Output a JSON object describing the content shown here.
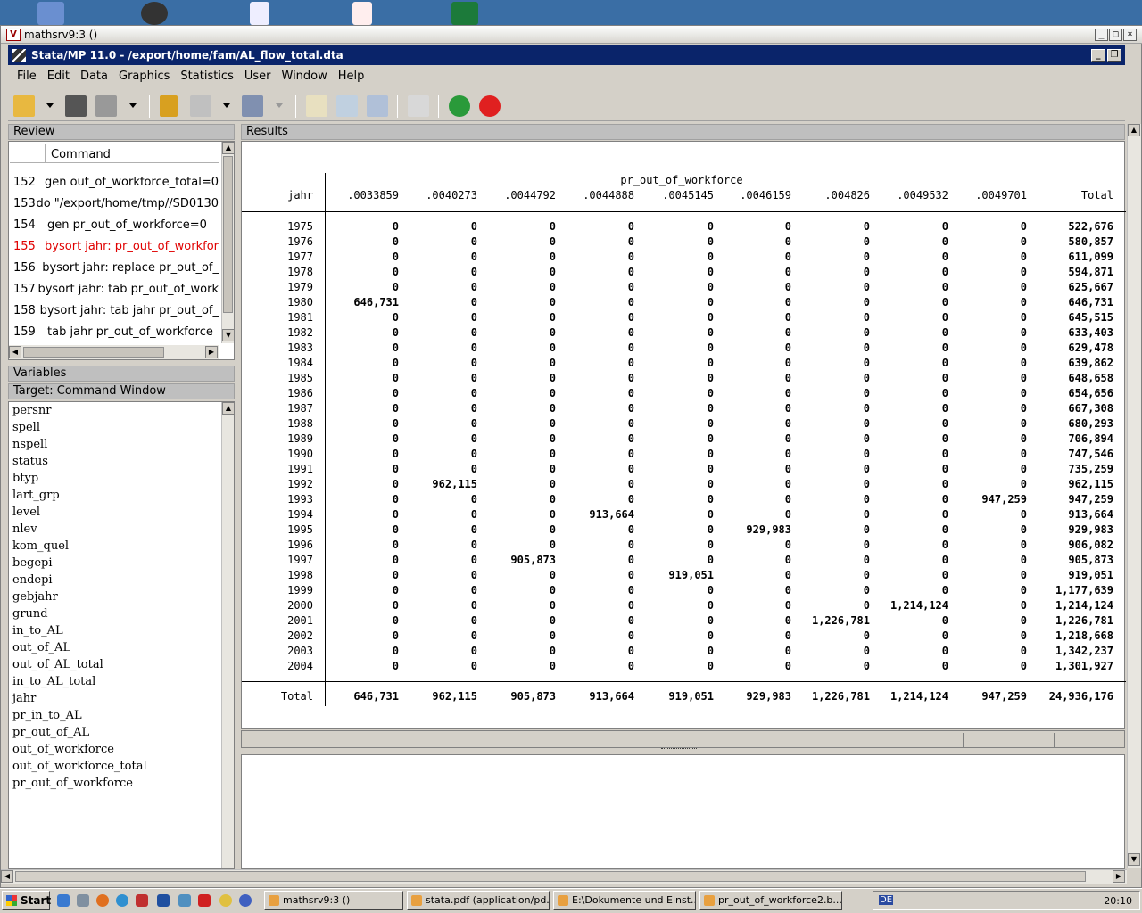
{
  "window": {
    "vnc_title": "mathsrv9:3 ()",
    "stata_title": "Stata/MP 11.0 - /export/home/fam/AL_flow_total.dta"
  },
  "menu": [
    "File",
    "Edit",
    "Data",
    "Graphics",
    "Statistics",
    "User",
    "Window",
    "Help"
  ],
  "review": {
    "header": "Review",
    "column": "Command",
    "rows": [
      {
        "n": "152",
        "cmd": "gen out_of_workforce_total=0"
      },
      {
        "n": "153",
        "cmd": "do \"/export/home/tmp//SD0130"
      },
      {
        "n": "154",
        "cmd": "gen pr_out_of_workforce=0"
      },
      {
        "n": "155",
        "cmd": "bysort jahr: pr_out_of_workfor"
      },
      {
        "n": "156",
        "cmd": "bysort jahr: replace pr_out_of_"
      },
      {
        "n": "157",
        "cmd": "bysort jahr: tab pr_out_of_work"
      },
      {
        "n": "158",
        "cmd": "bysort jahr: tab jahr pr_out_of_"
      },
      {
        "n": "159",
        "cmd": "tab jahr pr_out_of_workforce"
      }
    ]
  },
  "variables": {
    "header": "Variables",
    "target": "Target: Command Window",
    "items": [
      "persnr",
      "spell",
      "nspell",
      "status",
      "btyp",
      "lart_grp",
      "level",
      "nlev",
      "kom_quel",
      "begepi",
      "endepi",
      "gebjahr",
      "grund",
      "in_to_AL",
      "out_of_AL",
      "out_of_AL_total",
      "in_to_AL_total",
      "jahr",
      "pr_in_to_AL",
      "pr_out_of_AL",
      "out_of_workforce",
      "out_of_workforce_total",
      "pr_out_of_workforce"
    ]
  },
  "results": {
    "header": "Results",
    "var_title": "pr_out_of_workforce",
    "row_var": "jahr",
    "columns": [
      ".0033859",
      ".0040273",
      ".0044792",
      ".0044888",
      ".0045145",
      ".0046159",
      ".004826",
      ".0049532",
      ".0049701"
    ],
    "total_label": "Total",
    "rows": [
      {
        "year": "1975",
        "vals": [
          "0",
          "0",
          "0",
          "0",
          "0",
          "0",
          "0",
          "0",
          "0"
        ],
        "total": "522,676"
      },
      {
        "year": "1976",
        "vals": [
          "0",
          "0",
          "0",
          "0",
          "0",
          "0",
          "0",
          "0",
          "0"
        ],
        "total": "580,857"
      },
      {
        "year": "1977",
        "vals": [
          "0",
          "0",
          "0",
          "0",
          "0",
          "0",
          "0",
          "0",
          "0"
        ],
        "total": "611,099"
      },
      {
        "year": "1978",
        "vals": [
          "0",
          "0",
          "0",
          "0",
          "0",
          "0",
          "0",
          "0",
          "0"
        ],
        "total": "594,871"
      },
      {
        "year": "1979",
        "vals": [
          "0",
          "0",
          "0",
          "0",
          "0",
          "0",
          "0",
          "0",
          "0"
        ],
        "total": "625,667"
      },
      {
        "year": "1980",
        "vals": [
          "646,731",
          "0",
          "0",
          "0",
          "0",
          "0",
          "0",
          "0",
          "0"
        ],
        "total": "646,731"
      },
      {
        "year": "1981",
        "vals": [
          "0",
          "0",
          "0",
          "0",
          "0",
          "0",
          "0",
          "0",
          "0"
        ],
        "total": "645,515"
      },
      {
        "year": "1982",
        "vals": [
          "0",
          "0",
          "0",
          "0",
          "0",
          "0",
          "0",
          "0",
          "0"
        ],
        "total": "633,403"
      },
      {
        "year": "1983",
        "vals": [
          "0",
          "0",
          "0",
          "0",
          "0",
          "0",
          "0",
          "0",
          "0"
        ],
        "total": "629,478"
      },
      {
        "year": "1984",
        "vals": [
          "0",
          "0",
          "0",
          "0",
          "0",
          "0",
          "0",
          "0",
          "0"
        ],
        "total": "639,862"
      },
      {
        "year": "1985",
        "vals": [
          "0",
          "0",
          "0",
          "0",
          "0",
          "0",
          "0",
          "0",
          "0"
        ],
        "total": "648,658"
      },
      {
        "year": "1986",
        "vals": [
          "0",
          "0",
          "0",
          "0",
          "0",
          "0",
          "0",
          "0",
          "0"
        ],
        "total": "654,656"
      },
      {
        "year": "1987",
        "vals": [
          "0",
          "0",
          "0",
          "0",
          "0",
          "0",
          "0",
          "0",
          "0"
        ],
        "total": "667,308"
      },
      {
        "year": "1988",
        "vals": [
          "0",
          "0",
          "0",
          "0",
          "0",
          "0",
          "0",
          "0",
          "0"
        ],
        "total": "680,293"
      },
      {
        "year": "1989",
        "vals": [
          "0",
          "0",
          "0",
          "0",
          "0",
          "0",
          "0",
          "0",
          "0"
        ],
        "total": "706,894"
      },
      {
        "year": "1990",
        "vals": [
          "0",
          "0",
          "0",
          "0",
          "0",
          "0",
          "0",
          "0",
          "0"
        ],
        "total": "747,546"
      },
      {
        "year": "1991",
        "vals": [
          "0",
          "0",
          "0",
          "0",
          "0",
          "0",
          "0",
          "0",
          "0"
        ],
        "total": "735,259"
      },
      {
        "year": "1992",
        "vals": [
          "0",
          "962,115",
          "0",
          "0",
          "0",
          "0",
          "0",
          "0",
          "0"
        ],
        "total": "962,115"
      },
      {
        "year": "1993",
        "vals": [
          "0",
          "0",
          "0",
          "0",
          "0",
          "0",
          "0",
          "0",
          "947,259"
        ],
        "total": "947,259"
      },
      {
        "year": "1994",
        "vals": [
          "0",
          "0",
          "0",
          "913,664",
          "0",
          "0",
          "0",
          "0",
          "0"
        ],
        "total": "913,664"
      },
      {
        "year": "1995",
        "vals": [
          "0",
          "0",
          "0",
          "0",
          "0",
          "929,983",
          "0",
          "0",
          "0"
        ],
        "total": "929,983"
      },
      {
        "year": "1996",
        "vals": [
          "0",
          "0",
          "0",
          "0",
          "0",
          "0",
          "0",
          "0",
          "0"
        ],
        "total": "906,082"
      },
      {
        "year": "1997",
        "vals": [
          "0",
          "0",
          "905,873",
          "0",
          "0",
          "0",
          "0",
          "0",
          "0"
        ],
        "total": "905,873"
      },
      {
        "year": "1998",
        "vals": [
          "0",
          "0",
          "0",
          "0",
          "919,051",
          "0",
          "0",
          "0",
          "0"
        ],
        "total": "919,051"
      },
      {
        "year": "1999",
        "vals": [
          "0",
          "0",
          "0",
          "0",
          "0",
          "0",
          "0",
          "0",
          "0"
        ],
        "total": "1,177,639"
      },
      {
        "year": "2000",
        "vals": [
          "0",
          "0",
          "0",
          "0",
          "0",
          "0",
          "0",
          "1,214,124",
          "0"
        ],
        "total": "1,214,124"
      },
      {
        "year": "2001",
        "vals": [
          "0",
          "0",
          "0",
          "0",
          "0",
          "0",
          "1,226,781",
          "0",
          "0"
        ],
        "total": "1,226,781"
      },
      {
        "year": "2002",
        "vals": [
          "0",
          "0",
          "0",
          "0",
          "0",
          "0",
          "0",
          "0",
          "0"
        ],
        "total": "1,218,668"
      },
      {
        "year": "2003",
        "vals": [
          "0",
          "0",
          "0",
          "0",
          "0",
          "0",
          "0",
          "0",
          "0"
        ],
        "total": "1,342,237"
      },
      {
        "year": "2004",
        "vals": [
          "0",
          "0",
          "0",
          "0",
          "0",
          "0",
          "0",
          "0",
          "0"
        ],
        "total": "1,301,927"
      }
    ],
    "totals": {
      "label": "Total",
      "vals": [
        "646,731",
        "962,115",
        "905,873",
        "913,664",
        "919,051",
        "929,983",
        "1,226,781",
        "1,214,124",
        "947,259"
      ],
      "total": "24,936,176"
    }
  },
  "taskbar": {
    "start": "Start",
    "tasks": [
      "mathsrv9:3 ()",
      "stata.pdf (application/pd...",
      "E:\\Dokumente und Einst...",
      "pr_out_of_workforce2.b..."
    ],
    "lang": "DE",
    "clock": "20:10"
  }
}
